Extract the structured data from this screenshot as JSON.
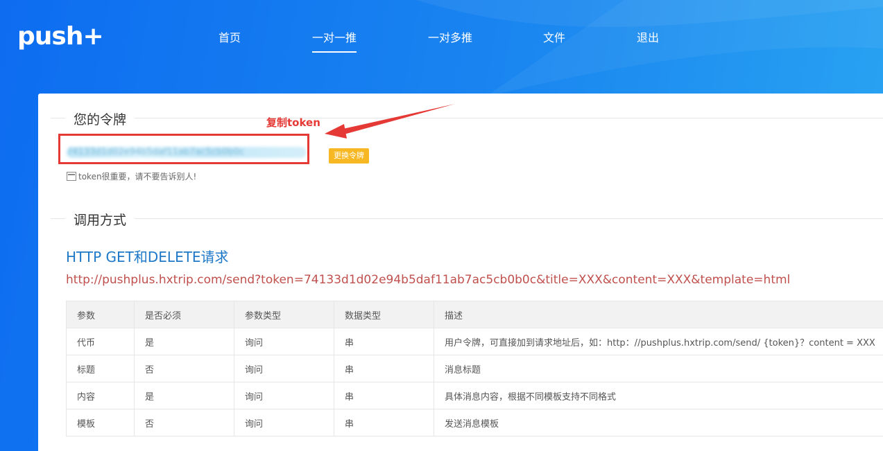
{
  "brand": {
    "logo": "push+"
  },
  "nav": {
    "items": [
      {
        "label": "首页"
      },
      {
        "label": "一对一推"
      },
      {
        "label": "一对多推"
      },
      {
        "label": "文件"
      },
      {
        "label": "退出"
      }
    ],
    "active_index": 1
  },
  "token_section": {
    "legend": "您的令牌",
    "token_value": "74133d1d02e94b5daf11ab7ac5cb0b0c",
    "change_button": "更换令牌",
    "tip": "token很重要，请不要告诉别人!",
    "annotation": "复制token"
  },
  "usage_section": {
    "legend": "调用方式",
    "api_title": "HTTP GET和DELETE请求",
    "api_url": "http://pushplus.hxtrip.com/send?token=74133d1d02e94b5daf11ab7ac5cb0b0c&title=XXX&content=XXX&template=html"
  },
  "params_table": {
    "headers": [
      "参数",
      "是否必须",
      "参数类型",
      "数据类型",
      "描述"
    ],
    "rows": [
      [
        "代币",
        "是",
        "询问",
        "串",
        "用户令牌，可直接加到请求地址后，如：http：//pushplus.hxtrip.com/send/ {token}？content = XXX"
      ],
      [
        "标题",
        "否",
        "询问",
        "串",
        "消息标题"
      ],
      [
        "内容",
        "是",
        "询问",
        "串",
        "具体消息内容，根据不同模板支持不同格式"
      ],
      [
        "模板",
        "否",
        "询问",
        "串",
        "发送消息模板"
      ]
    ]
  },
  "colors": {
    "header_bg": "#1a86f0",
    "link_blue": "#1e78c8",
    "url_red": "#c0504d",
    "annotation_red": "#e53935",
    "button_orange": "#f7b824"
  }
}
